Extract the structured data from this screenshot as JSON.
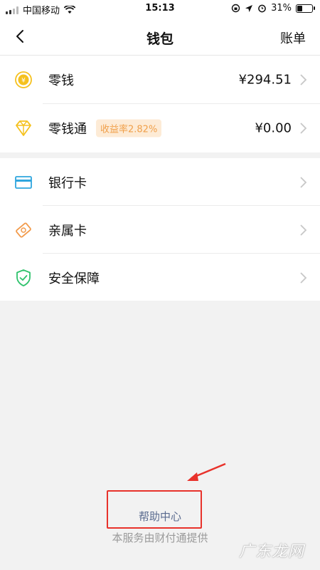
{
  "status_bar": {
    "carrier": "中国移动",
    "time": "15:13",
    "battery": "31%",
    "battery_level": 0.31
  },
  "nav": {
    "title": "钱包",
    "action": "账单",
    "back_icon": "chevron-left-icon"
  },
  "balances": [
    {
      "label": "零钱",
      "value": "¥294.51",
      "icon": "yuan-coin-icon",
      "color": "#f5c11e"
    },
    {
      "label": "零钱通",
      "badge": "收益率2.82%",
      "value": "¥0.00",
      "icon": "diamond-icon",
      "color": "#f5c11e"
    }
  ],
  "services": [
    {
      "label": "银行卡",
      "icon": "bank-card-icon",
      "color": "#2fa6de"
    },
    {
      "label": "亲属卡",
      "icon": "family-card-icon",
      "color": "#f29a4a"
    },
    {
      "label": "安全保障",
      "icon": "shield-check-icon",
      "color": "#2dc26b"
    }
  ],
  "footer": {
    "help_link": "帮助中心",
    "provider_note": "本服务由财付通提供"
  },
  "watermark": "广东龙网",
  "colors": {
    "annotation": "#e8322b",
    "link": "#5a6b8f",
    "badge_bg": "#fdebd6",
    "badge_text": "#f0a04b"
  }
}
